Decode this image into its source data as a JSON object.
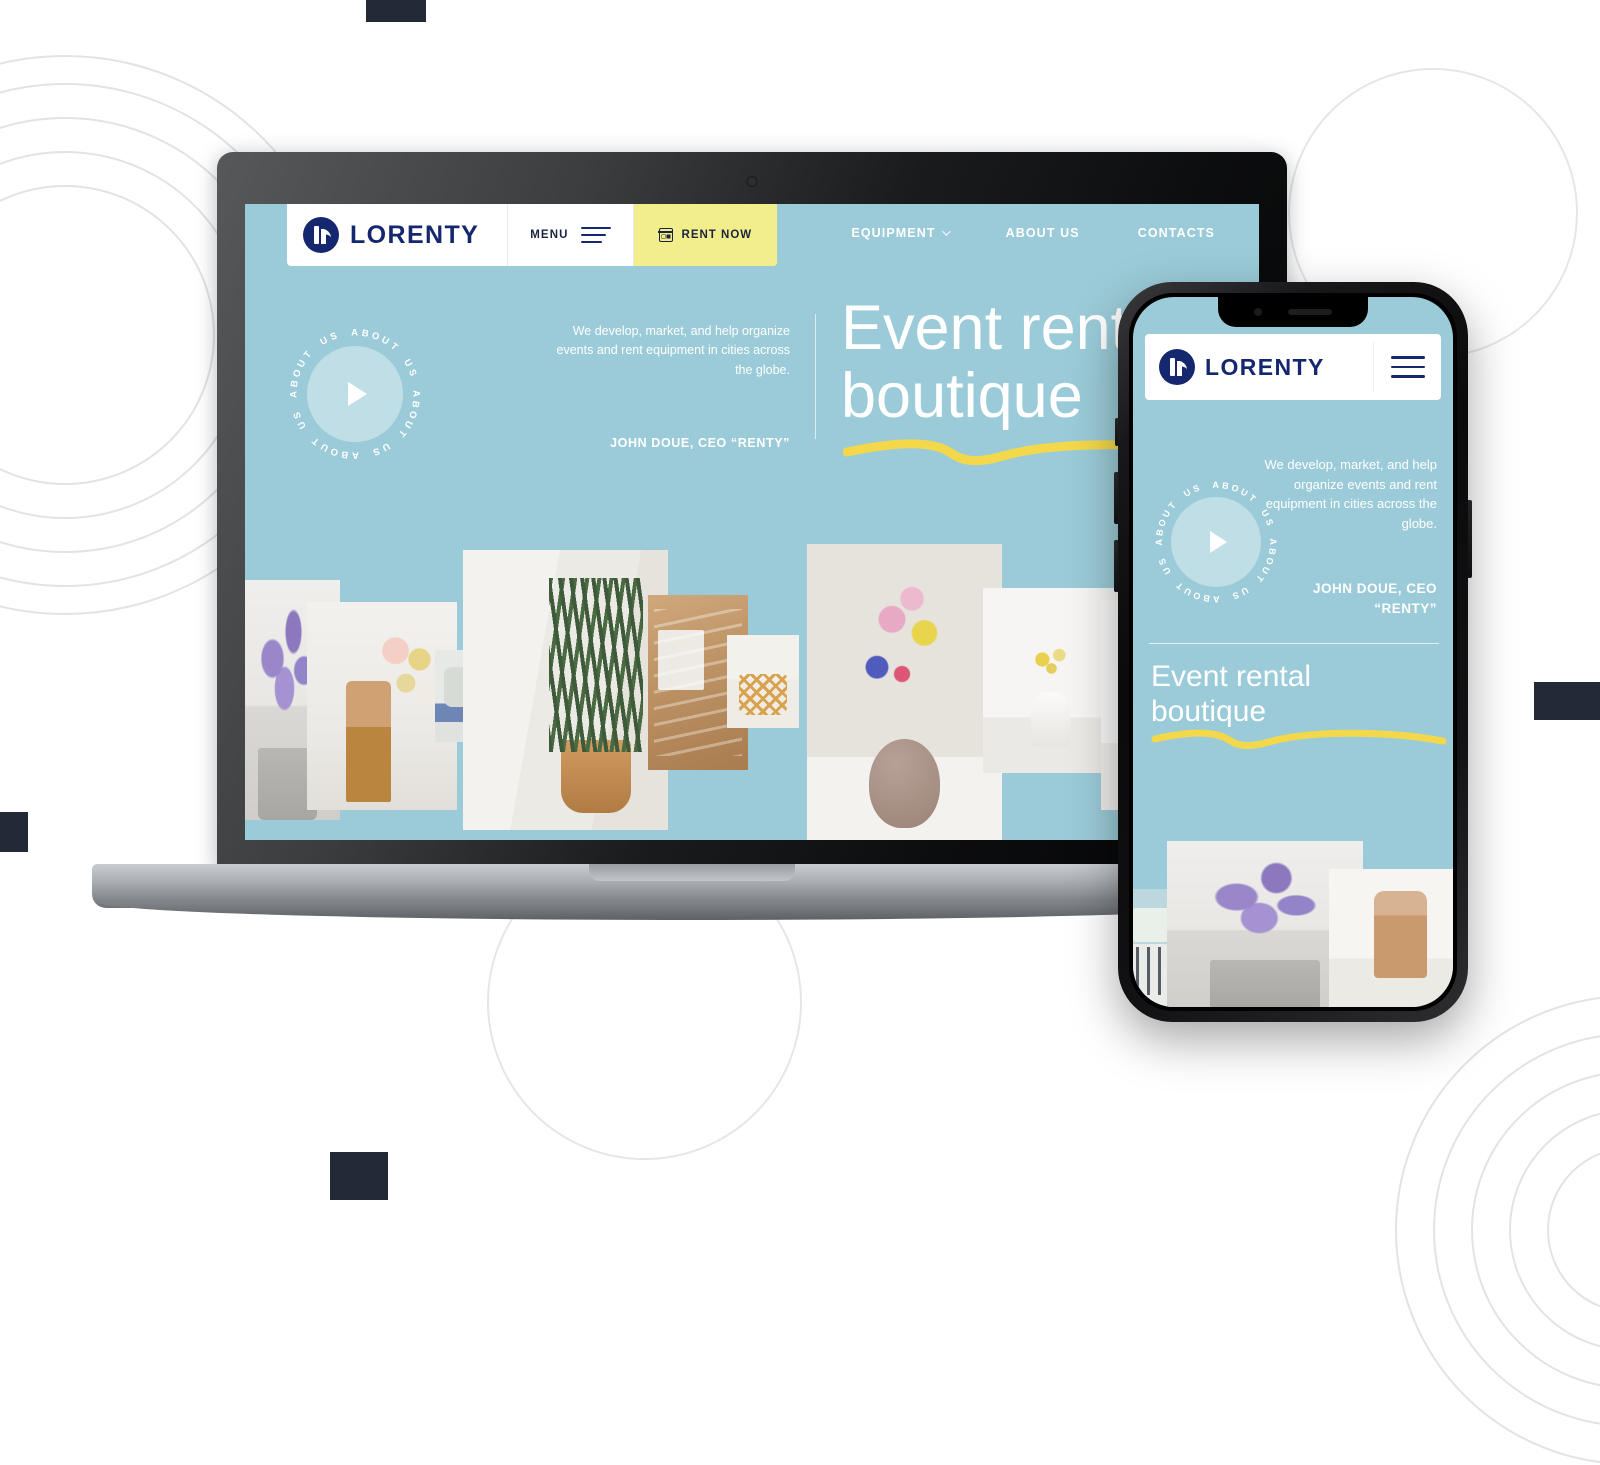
{
  "brand": {
    "name": "LORENTY",
    "logo_mark": "lr-monogram",
    "navy": "#15276E",
    "accent_yellow": "#F2EE8C",
    "hero_bg": "#9BCBD8",
    "squiggle": "#F3D84B",
    "deco_square": "#232936"
  },
  "desktop": {
    "header": {
      "logo_text": "LORENTY",
      "menu_label": "MENU",
      "rent_label": "RENT NOW",
      "nav": [
        {
          "label": "EQUIPMENT",
          "has_dropdown": true
        },
        {
          "label": "ABOUT US",
          "has_dropdown": false
        },
        {
          "label": "CONTACTS",
          "has_dropdown": false
        }
      ]
    },
    "hero": {
      "badge_text": "ABOUT US ABOUT US ABOUT US ABOUT US ",
      "play_icon": "play-triangle-icon",
      "description": "We develop, market, and help organize events and rent equipment in cities across the globe.",
      "author": "JOHN DOUE, CEO “RENTY”",
      "title_line1": "Event rental",
      "title_line2": "boutique"
    },
    "gallery": [
      {
        "name": "lavender-in-grey-pot"
      },
      {
        "name": "child-with-balloons"
      },
      {
        "name": "sofa-corner"
      },
      {
        "name": "snake-plant-in-terracotta-pot"
      },
      {
        "name": "wooden-table-setting"
      },
      {
        "name": "rattan-side-table"
      },
      {
        "name": "pink-blossom-vase"
      },
      {
        "name": "white-vase-on-pedestal"
      },
      {
        "name": "pedestal-display"
      }
    ]
  },
  "mobile": {
    "header": {
      "logo_text": "LORENTY",
      "menu_icon": "hamburger-menu-icon"
    },
    "hero": {
      "badge_text": "ABOUT US ABOUT US ABOUT US ABOUT US ",
      "play_icon": "play-triangle-icon",
      "description": "We develop, market, and help organize events and rent equipment in cities across the globe.",
      "author": "JOHN DOUE, CEO “RENTY”",
      "title_line1": "Event rental",
      "title_line2": "boutique"
    },
    "gallery": [
      {
        "name": "napkin-and-forks"
      },
      {
        "name": "lavender-bouquet"
      },
      {
        "name": "child-with-balloons"
      }
    ]
  },
  "mockup": {
    "laptop_label": "laptop-device-mockup",
    "phone_label": "phone-device-mockup"
  }
}
